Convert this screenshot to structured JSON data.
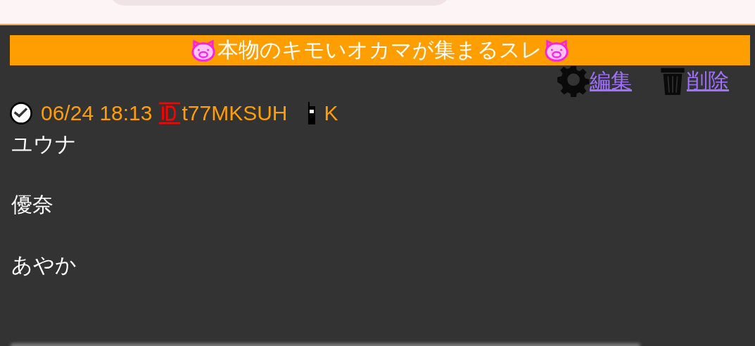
{
  "thread_title": "本物のキモいオカマが集まるスレ",
  "actions": [
    {
      "kind": "edit",
      "label": "編集"
    },
    {
      "kind": "delete",
      "label": "削除"
    }
  ],
  "post": {
    "date": "06/24 18:13",
    "id": "t77MKSUH",
    "device": "K",
    "body_lines": [
      "ユウナ",
      "優奈",
      "あやか"
    ]
  }
}
